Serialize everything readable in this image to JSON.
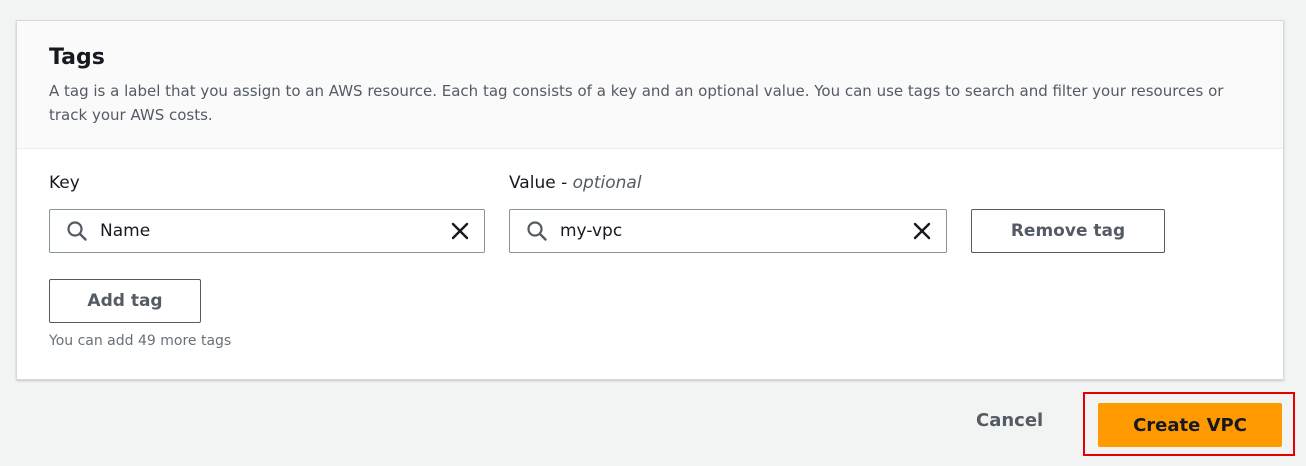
{
  "tags_panel": {
    "title": "Tags",
    "description": "A tag is a label that you assign to an AWS resource. Each tag consists of a key and an optional value. You can use tags to search and filter your resources or track your AWS costs.",
    "key_label": "Key",
    "value_label": "Value - ",
    "value_label_optional": "optional",
    "tag_row": {
      "key_value": "Name",
      "value_value": "my-vpc"
    },
    "remove_tag_label": "Remove tag",
    "add_tag_label": "Add tag",
    "tags_remaining_hint": "You can add 49 more tags"
  },
  "footer": {
    "cancel_label": "Cancel",
    "create_label": "Create VPC"
  },
  "colors": {
    "primary": "#ff9900",
    "highlight_border": "#e60000"
  },
  "icons": [
    "search-icon",
    "clear-icon"
  ]
}
